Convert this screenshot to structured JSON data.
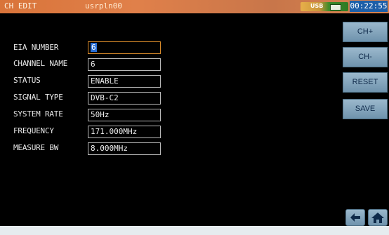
{
  "header": {
    "title": "CH EDIT",
    "user": "usrpln00",
    "usb_tag": "USB",
    "clock": "00:22:55"
  },
  "fields": [
    {
      "label": "EIA NUMBER",
      "value": "6",
      "selected": true
    },
    {
      "label": "CHANNEL NAME",
      "value": "6"
    },
    {
      "label": "STATUS",
      "value": "ENABLE"
    },
    {
      "label": "SIGNAL TYPE",
      "value": "DVB-C2"
    },
    {
      "label": "SYSTEM RATE",
      "value": "50Hz"
    },
    {
      "label": "FREQUENCY",
      "value": "171.000MHz"
    },
    {
      "label": "MEASURE BW",
      "value": "8.000MHz"
    }
  ],
  "buttons": {
    "ch_plus": "CH+",
    "ch_minus": "CH-",
    "reset": "RESET",
    "save": "SAVE"
  },
  "nav": {
    "back_icon": "arrow-left-icon",
    "home_icon": "home-icon"
  }
}
